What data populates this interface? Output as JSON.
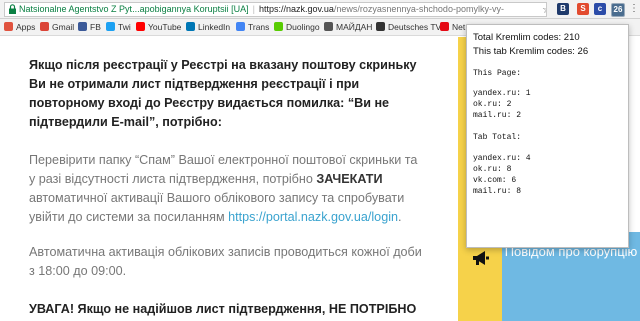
{
  "browser": {
    "site_identity": "Natsionalne Agentstvo Z Pyt...apobigannya Koruptsii [UA]",
    "url_host": "https://nazk.gov.ua",
    "url_path": "/news/rozyasnennya-shchodo-pomylky-vy-",
    "extensions": [
      "B",
      "S",
      "c"
    ],
    "extension_badge": "26",
    "bookmarks": [
      {
        "label": "Apps",
        "color": "#e0533f"
      },
      {
        "label": "Gmail",
        "color": "#db4437"
      },
      {
        "label": "FB",
        "color": "#3b5998"
      },
      {
        "label": "Twi",
        "color": "#1da1f2"
      },
      {
        "label": "YouTube",
        "color": "#ff0000"
      },
      {
        "label": "LinkedIn",
        "color": "#0077b5"
      },
      {
        "label": "Trans",
        "color": "#4285f4"
      },
      {
        "label": "Duolingo",
        "color": "#58cc02"
      },
      {
        "label": "МАЙДАН",
        "color": "#555555"
      },
      {
        "label": "Deutsches TV",
        "color": "#333333"
      },
      {
        "label": "Net",
        "color": "#e50914"
      }
    ]
  },
  "article": {
    "heading": "Якщо після реєстрації у Реєстрі на вказану поштову скриньку Ви не отримали лист підтвердження реєстрації і при повторному вході до Реєстру видається помилка: “Ви не підтвердили E-mail”, потрібно:",
    "para1_before": "Перевірити папку “Спам” Вашої електронної поштової скриньки та у разі відсутності листа підтвердження, потрібно ",
    "para1_bold": "ЗАЧЕКАТИ",
    "para1_after": " автоматичної активації Вашого облікового запису та спробувати увійти до системи за посиланням ",
    "link": "https://portal.nazk.gov.ua/login",
    "link_end": ".",
    "para2": "Автоматична активація облікових записів проводиться кожної доби з 18:00 до 09:00.",
    "para3": "УВАГА! Якщо не надійшов лист підтвердження, НЕ ПОТРІБНО"
  },
  "sidebar": {
    "banner": "Повідом про корупцію",
    "icon": "megaphone-icon"
  },
  "popup": {
    "total_label": "Total Kremlim codes: 210",
    "tab_label": "This tab Kremlim codes: 26",
    "this_page_title": "This Page:",
    "this_page_lines": [
      "yandex.ru: 1",
      "ok.ru: 2",
      "mail.ru: 2"
    ],
    "tab_total_title": "Tab Total:",
    "tab_total_lines": [
      "yandex.ru: 4",
      "ok.ru: 8",
      "vk.com: 6",
      "mail.ru: 8"
    ]
  }
}
